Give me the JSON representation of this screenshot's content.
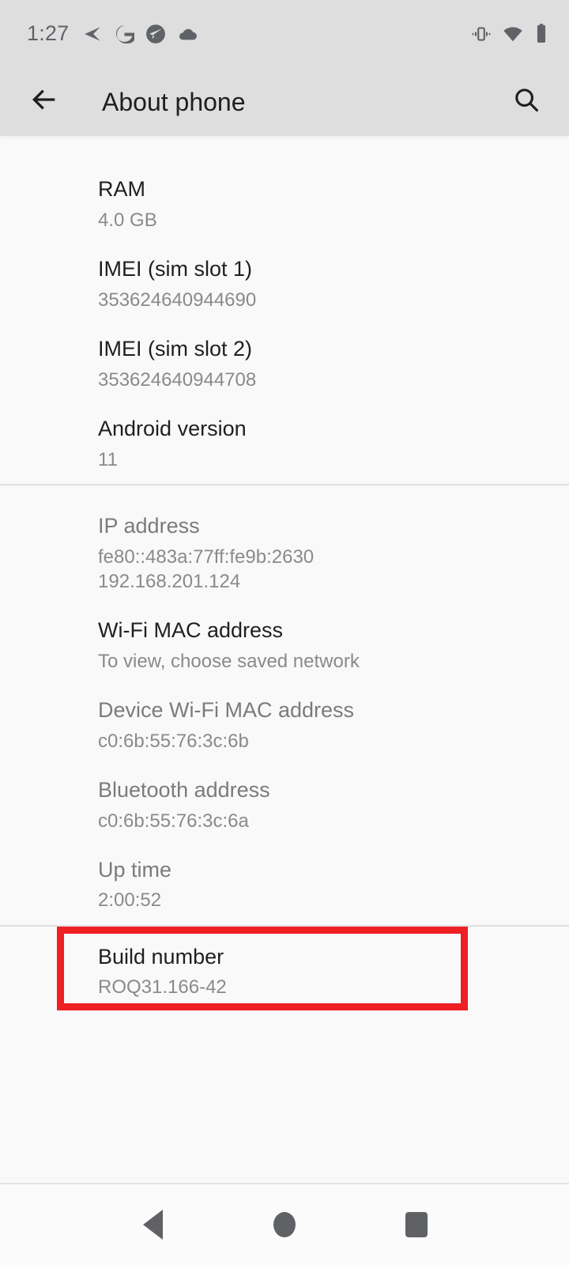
{
  "status_bar": {
    "time": "1:27",
    "notification_icons": [
      "send-icon",
      "google-g-icon",
      "telegram-icon",
      "cloud-icon"
    ],
    "system_icons": [
      "vibrate-icon",
      "wifi-icon",
      "battery-icon"
    ]
  },
  "app_bar": {
    "title": "About phone",
    "back_icon": "arrow-back-icon",
    "search_icon": "search-icon"
  },
  "rows": [
    {
      "title": "RAM",
      "values": [
        "4.0 GB"
      ],
      "dim": false
    },
    {
      "title": "IMEI (sim slot 1)",
      "values": [
        "353624640944690"
      ],
      "dim": false
    },
    {
      "title": "IMEI (sim slot 2)",
      "values": [
        "353624640944708"
      ],
      "dim": false
    },
    {
      "title": "Android version",
      "values": [
        "11"
      ],
      "dim": false
    },
    {
      "title": "IP address",
      "values": [
        "fe80::483a:77ff:fe9b:2630",
        "192.168.201.124"
      ],
      "dim": true
    },
    {
      "title": "Wi-Fi MAC address",
      "values": [
        "To view, choose saved network"
      ],
      "dim": false
    },
    {
      "title": "Device Wi-Fi MAC address",
      "values": [
        "c0:6b:55:76:3c:6b"
      ],
      "dim": true
    },
    {
      "title": "Bluetooth address",
      "values": [
        "c0:6b:55:76:3c:6a"
      ],
      "dim": true
    },
    {
      "title": "Up time",
      "values": [
        "2:00:52"
      ],
      "dim": true
    }
  ],
  "build_number": {
    "title": "Build number",
    "value": "ROQ31.166-42"
  },
  "nav_bar": {
    "back_label": "Back",
    "home_label": "Home",
    "recents_label": "Recents"
  },
  "colors": {
    "highlight": "#ee2024",
    "app_bar_bg": "#dedede",
    "content_bg": "#f9f9f9",
    "title_text": "#1f1f1f",
    "value_text": "#8a8a8a",
    "dim_title_text": "#7b7b7b"
  }
}
